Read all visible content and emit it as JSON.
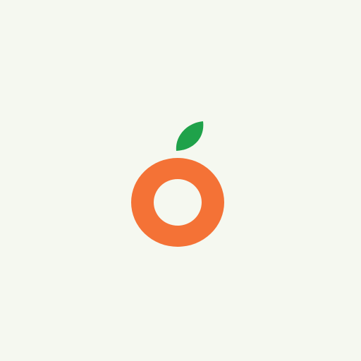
{
  "app": {
    "background_color": "#f5f8f0"
  },
  "logo": {
    "icon": "orange-fruit-icon",
    "ring_color": "#f47236",
    "leaf_color": "#1fa24a"
  }
}
